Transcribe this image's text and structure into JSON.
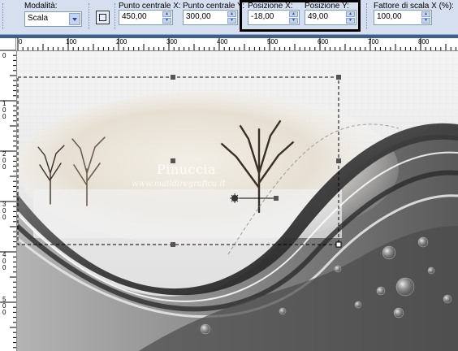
{
  "toolbar": {
    "mode_label": "Modalità:",
    "mode_value": "Scala",
    "center_x_label": "Punto centrale X:",
    "center_x_value": "450,00",
    "center_y_label": "Punto centrale Y:",
    "center_y_value": "300,00",
    "pos_x_label": "Posizione X:",
    "pos_x_value": "-18,00",
    "pos_y_label": "Posizione Y:",
    "pos_y_value": "49,00",
    "scale_x_label": "Fattore di scala X (%):",
    "scale_x_value": "100,00"
  },
  "ruler": {
    "h_numbers": [
      "0",
      "100",
      "200",
      "300",
      "400",
      "500",
      "600",
      "700",
      "800"
    ],
    "v_numbers": [
      "0",
      "1\n0\n0",
      "2\n0\n0",
      "3\n0\n0",
      "4\n0\n0",
      "5\n0\n0"
    ]
  },
  "canvas": {
    "watermark_name": "Pinuccia",
    "watermark_url": "www.maildiregrafica.it"
  },
  "colors": {
    "toolbar_bg": "#d6dff0",
    "frame_bg": "#3e5f8a",
    "highlight_border": "#000000"
  }
}
